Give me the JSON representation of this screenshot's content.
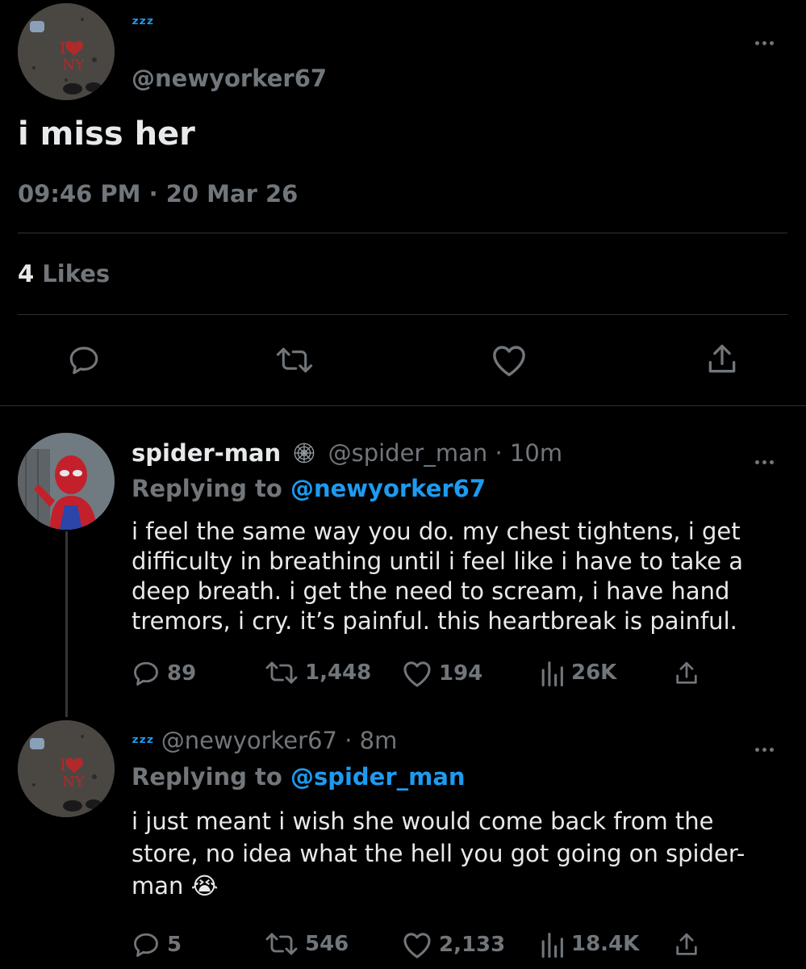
{
  "main_tweet": {
    "display_name": "ᶻᶻᶻ",
    "handle": "@newyorker67",
    "text": "i miss her",
    "timestamp": "09:46 PM · 20 Mar 26",
    "likes_count": "4",
    "likes_label": "Likes"
  },
  "replies": [
    {
      "display_name": "spider-man",
      "handle": "@spider_man",
      "time": "· 10m",
      "replying_prefix": "Replying to",
      "replying_to": "@newyorker67",
      "text_lines": [
        "i feel the same way you do. my chest tightens, i get",
        "difficulty in breathing until i feel like i have to take a",
        "deep breath. i get the need to scream, i have hand",
        "tremors, i cry. it’s painful. this heartbreak is painful."
      ],
      "stats": {
        "replies": "89",
        "retweets": "1,448",
        "likes": "194",
        "views": "26K"
      }
    },
    {
      "display_name": "ᶻᶻᶻ",
      "handle": "@newyorker67",
      "time": "· 8m",
      "replying_prefix": "Replying to",
      "replying_to": "@spider_man",
      "text_lines": [
        "i just meant i wish she would come back from the",
        "store, no idea what the hell you got going on spider-",
        "man 😭"
      ],
      "stats": {
        "replies": "5",
        "retweets": "546",
        "likes": "2,133",
        "views": "18.4K"
      }
    }
  ],
  "avatar_text": {
    "line1": "I",
    "line2": "NY"
  },
  "colors": {
    "background": "#000000",
    "text": "#e7e9ea",
    "muted": "#71767b",
    "link": "#1d9bf0",
    "divider": "#2f3336"
  }
}
